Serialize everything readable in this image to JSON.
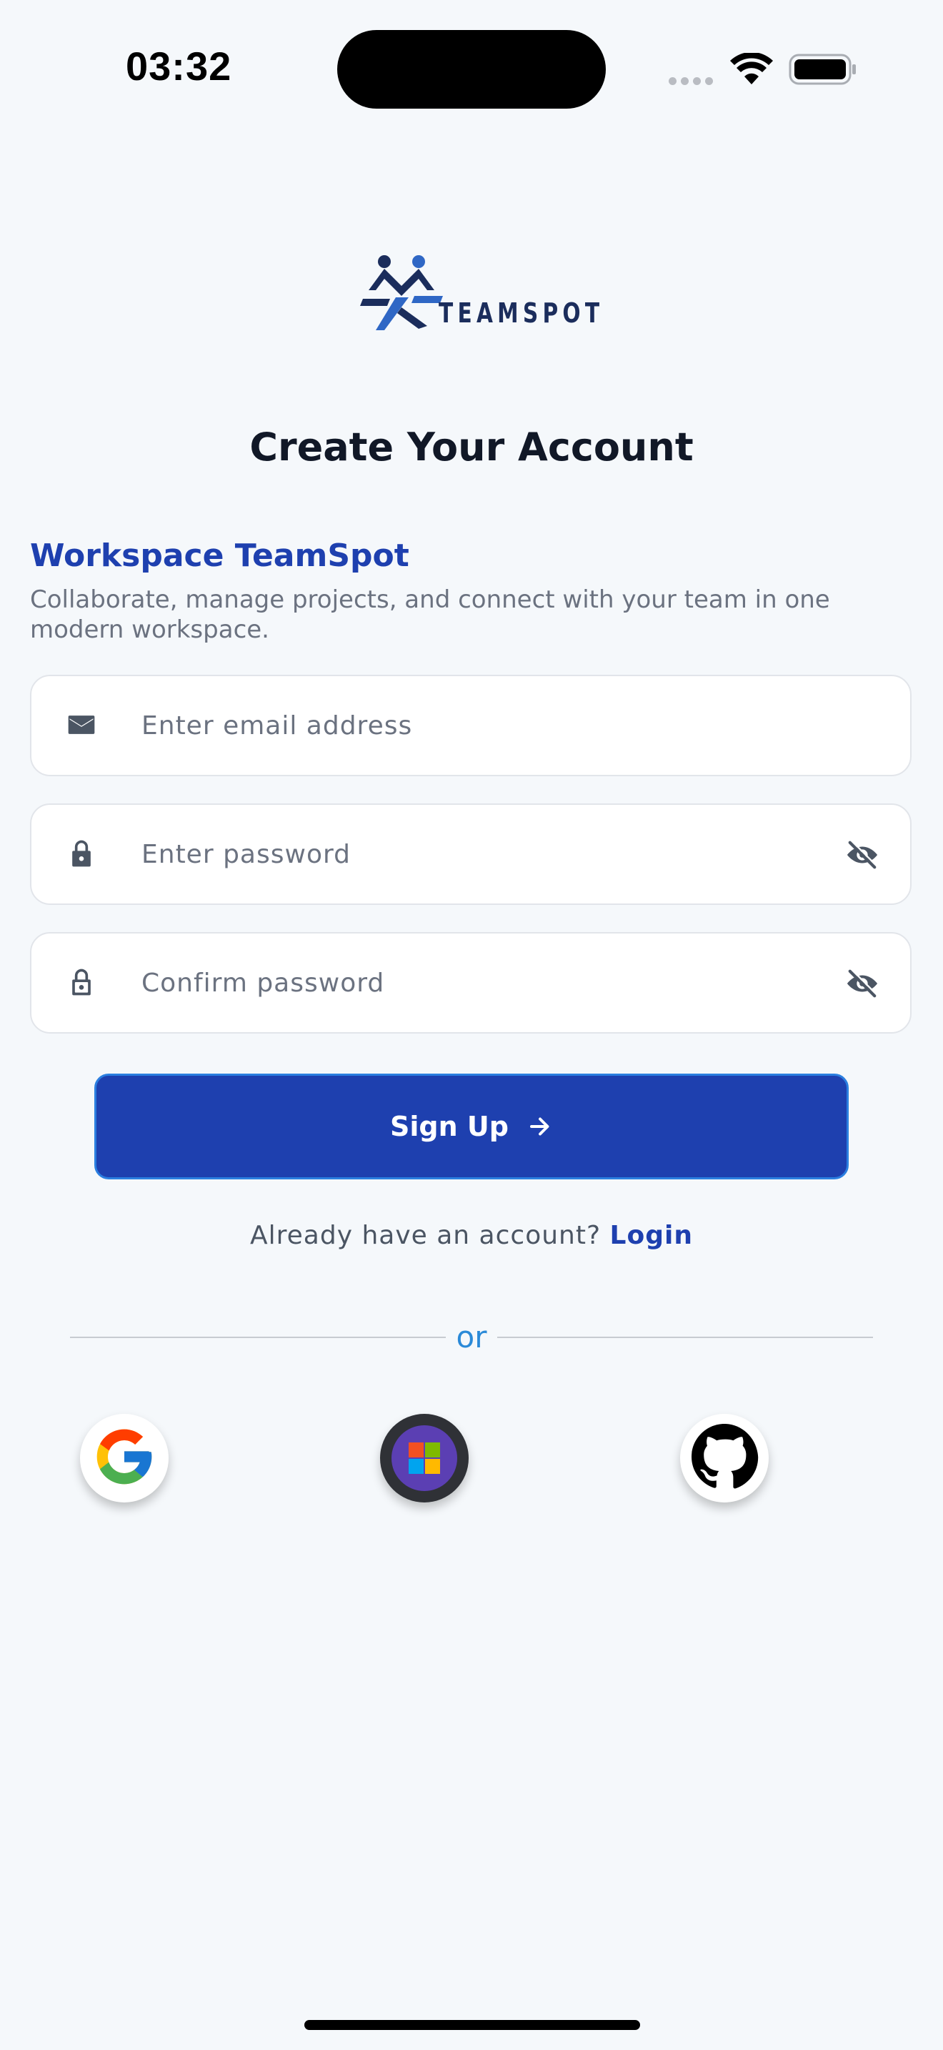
{
  "status_bar": {
    "time": "03:32"
  },
  "logo": {
    "wordmark": "TEAMSPOT"
  },
  "page": {
    "title": "Create Your Account"
  },
  "intro": {
    "heading": "Workspace TeamSpot",
    "description": "Collaborate, manage projects, and connect with your team in one modern workspace."
  },
  "form": {
    "email_placeholder": "Enter email address",
    "password_placeholder": "Enter password",
    "confirm_placeholder": "Confirm password",
    "email_icon": "mail-icon",
    "password_icon": "lock-icon",
    "confirm_icon": "lock-open-icon",
    "visibility_icon": "eye-off-icon"
  },
  "actions": {
    "signup_label": "Sign Up",
    "login_prompt": "Already have an account?",
    "login_link": "Login",
    "divider_text": "or"
  },
  "social": [
    "google",
    "microsoft",
    "github"
  ],
  "colors": {
    "primary": "#1e40af",
    "background": "#f5f8fb",
    "accent_link": "#2b8ad8"
  }
}
